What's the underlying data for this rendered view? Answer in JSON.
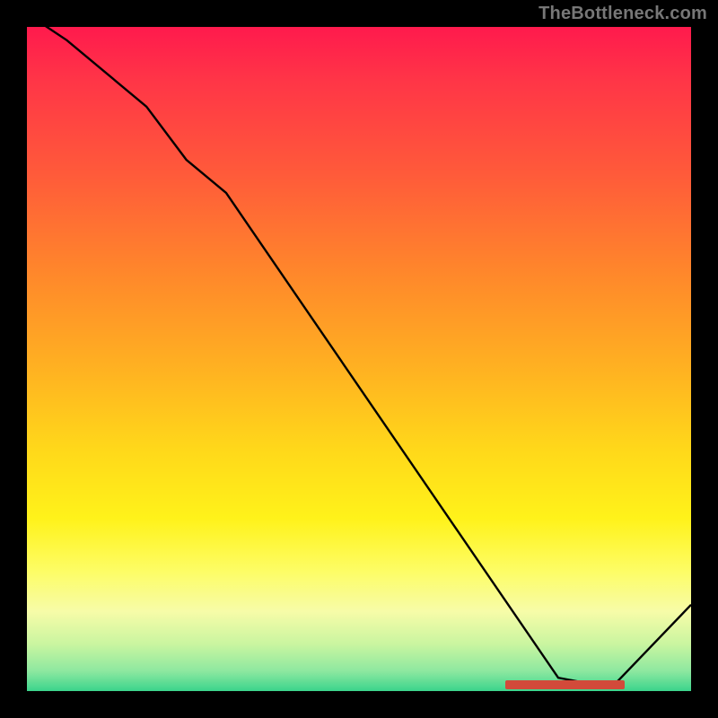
{
  "watermark": "TheBottleneck.com",
  "chart_data": {
    "type": "line",
    "title": "",
    "xlabel": "",
    "ylabel": "",
    "xlim": [
      0,
      100
    ],
    "ylim": [
      0,
      100
    ],
    "grid": false,
    "series": [
      {
        "name": "curve",
        "x": [
          0,
          6,
          18,
          24,
          30,
          80,
          88,
          100
        ],
        "y": [
          102,
          98,
          88,
          80,
          75,
          2,
          0.5,
          13
        ]
      }
    ],
    "marker": {
      "x_start": 72,
      "x_end": 90,
      "y": 1,
      "color": "#d24a3a"
    },
    "background_gradient": {
      "top": "#ff1a4d",
      "mid": "#ffd91a",
      "bottom": "#3bd48c"
    }
  }
}
